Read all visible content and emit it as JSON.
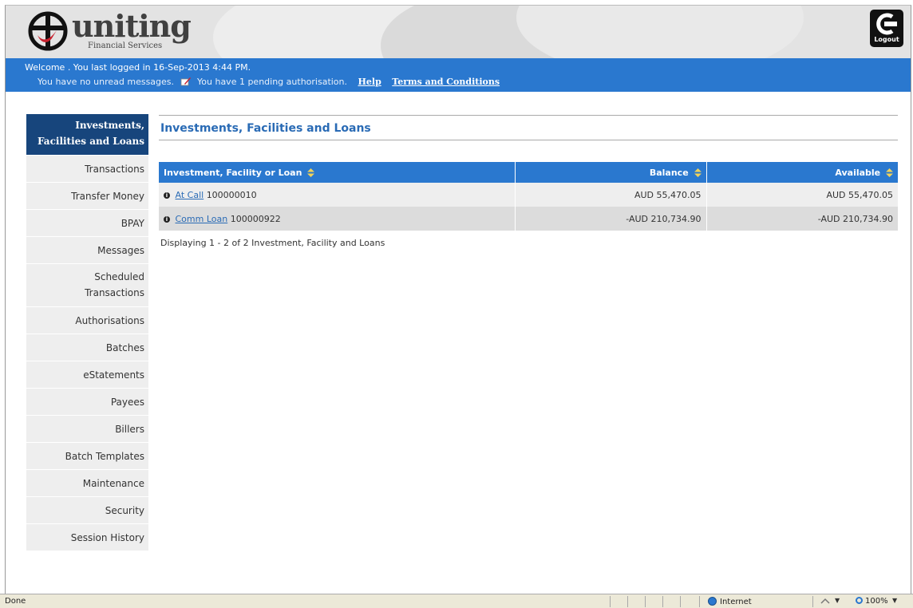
{
  "brand": {
    "name": "uniting",
    "subtitle": "Financial Services"
  },
  "header": {
    "logout_label": "Logout"
  },
  "infobar": {
    "welcome": "Welcome . You last logged in 16-Sep-2013 4:44 PM.",
    "messages": "You have no unread messages.",
    "pending": "You have 1 pending authorisation.",
    "help_link": "Help",
    "terms_link": "Terms and Conditions"
  },
  "sidebar": {
    "items": [
      {
        "label_line1": "Investments,",
        "label_line2": "Facilities and Loans",
        "active": true
      },
      {
        "label_line1": "Transactions",
        "label_line2": ""
      },
      {
        "label_line1": "Transfer Money",
        "label_line2": ""
      },
      {
        "label_line1": "BPAY",
        "label_line2": ""
      },
      {
        "label_line1": "Messages",
        "label_line2": ""
      },
      {
        "label_line1": "Scheduled",
        "label_line2": "Transactions"
      },
      {
        "label_line1": "Authorisations",
        "label_line2": ""
      },
      {
        "label_line1": "Batches",
        "label_line2": ""
      },
      {
        "label_line1": "eStatements",
        "label_line2": ""
      },
      {
        "label_line1": "Payees",
        "label_line2": ""
      },
      {
        "label_line1": "Billers",
        "label_line2": ""
      },
      {
        "label_line1": "Batch Templates",
        "label_line2": ""
      },
      {
        "label_line1": "Maintenance",
        "label_line2": ""
      },
      {
        "label_line1": "Security",
        "label_line2": ""
      },
      {
        "label_line1": "Session History",
        "label_line2": ""
      }
    ]
  },
  "main": {
    "title": "Investments, Facilities and Loans",
    "columns": [
      "Investment, Facility or Loan",
      "Balance",
      "Available"
    ],
    "rows": [
      {
        "account_name": "At Call",
        "account_number": "100000010",
        "balance": "AUD 55,470.05",
        "available": "AUD 55,470.05"
      },
      {
        "account_name": "Comm Loan",
        "account_number": "100000922",
        "balance": "-AUD 210,734.90",
        "available": "-AUD 210,734.90"
      }
    ],
    "footer": "Displaying 1 - 2 of 2 Investment, Facility and Loans"
  },
  "statusbar": {
    "status": "Done",
    "zone": "Internet",
    "zoom": "100%"
  },
  "colors": {
    "primary_blue": "#2a78cf",
    "nav_active": "#17457c",
    "link_blue": "#2a6bb5"
  }
}
